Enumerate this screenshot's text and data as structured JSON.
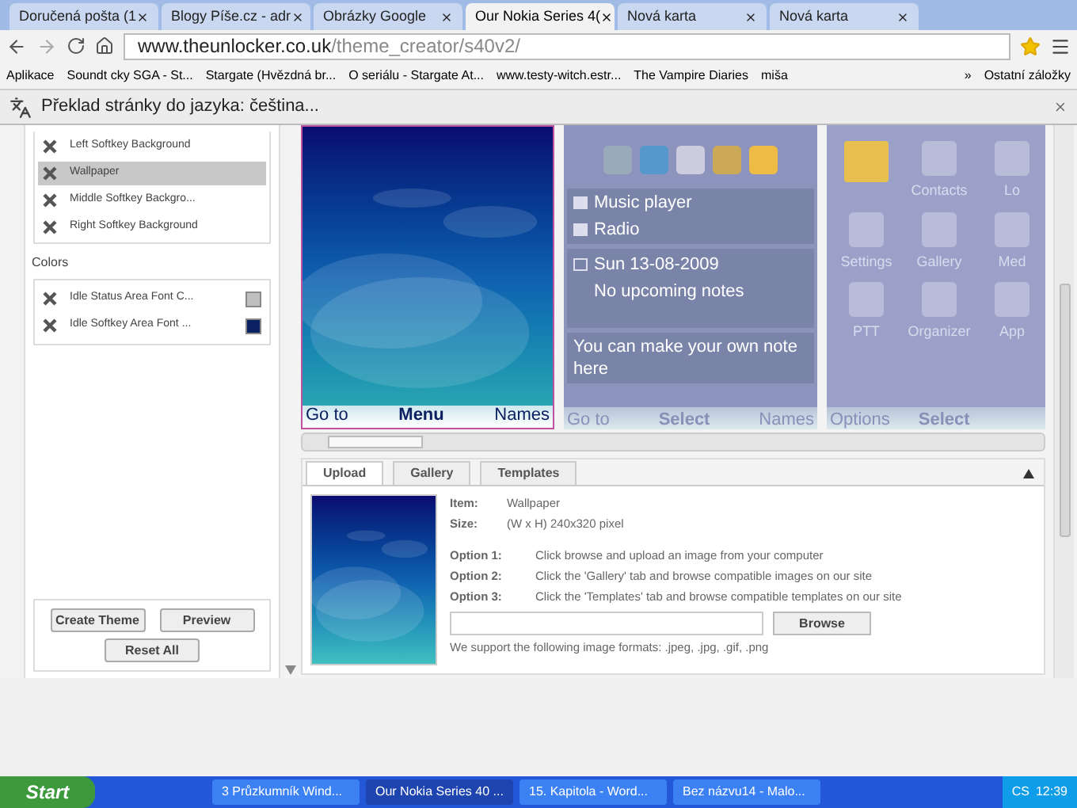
{
  "browser": {
    "tabs": [
      {
        "label": "Doručená pošta (1",
        "selected": false
      },
      {
        "label": "Blogy Píše.cz - adr",
        "selected": false
      },
      {
        "label": "Obrázky Google",
        "selected": false
      },
      {
        "label": "Our Nokia Series 4(",
        "selected": true
      },
      {
        "label": "Nová karta",
        "selected": false
      },
      {
        "label": "Nová karta",
        "selected": false
      }
    ],
    "address": {
      "host": "www.theunlocker.co.uk",
      "path": "/theme_creator/s40v2/"
    },
    "bookmarks": [
      {
        "label": "Aplikace"
      },
      {
        "label": "Soundt   cky SGA - St..."
      },
      {
        "label": "Stargate (Hvězdná br..."
      },
      {
        "label": "O seriálu - Stargate At..."
      },
      {
        "label": "www.testy-witch.estr..."
      },
      {
        "label": "The Vampire Diaries"
      },
      {
        "label": "miša"
      }
    ],
    "more_bookmarks": "»",
    "other_bookmarks": "Ostatní záložky",
    "translate_bar": "Překlad stránky do jazyka: čeština..."
  },
  "sidebar": {
    "items": [
      {
        "label": "Left Softkey Background",
        "selected": false
      },
      {
        "label": "Wallpaper",
        "selected": true
      },
      {
        "label": "Middle Softkey Backgro...",
        "selected": false
      },
      {
        "label": "Right Softkey Background",
        "selected": false
      }
    ],
    "colors_heading": "Colors",
    "colors": [
      {
        "label": "Idle Status Area Font C...",
        "color": "#c0c0c0"
      },
      {
        "label": "Idle Softkey Area Font ...",
        "color": "#0a2060"
      }
    ],
    "buttons": [
      "Create Theme",
      "Preview",
      "Reset All"
    ]
  },
  "previews": {
    "idle": {
      "softkeys": [
        "Go to",
        "Menu",
        "Names"
      ]
    },
    "active": {
      "items": [
        "Music player",
        "Radio"
      ],
      "date": "Sun 13-08-2009",
      "notes": "No upcoming notes",
      "note": "You can make your own note here",
      "softkeys": [
        "Go to",
        "Select",
        "Names"
      ]
    },
    "menu": {
      "labels": [
        "Contacts",
        "Lo",
        "Settings",
        "Gallery",
        "Med",
        "PTT",
        "Organizer",
        "App"
      ],
      "softkeys": [
        "Options",
        "Select"
      ]
    }
  },
  "upload": {
    "tabs": [
      {
        "label": "Upload",
        "selected": true
      },
      {
        "label": "Gallery",
        "selected": false
      },
      {
        "label": "Templates",
        "selected": false
      }
    ],
    "item_label": "Item:",
    "item_value": "Wallpaper",
    "size_label": "Size:",
    "size_value": "(W x H) 240x320 pixel",
    "options": [
      {
        "label": "Option 1:",
        "text": "Click browse and upload an image from your computer"
      },
      {
        "label": "Option 2:",
        "text": "Click the 'Gallery' tab and browse compatible images on our site"
      },
      {
        "label": "Option 3:",
        "text": "Click the 'Templates' tab and browse compatible templates on our site"
      }
    ],
    "browse": "Browse",
    "formats": "We support the following image formats: .jpeg, .jpg, .gif, .png"
  },
  "taskbar": {
    "start": "Start",
    "tasks": [
      {
        "label": "3 Průzkumník Wind...",
        "selected": false
      },
      {
        "label": "Our Nokia Series 40 ...",
        "selected": true
      },
      {
        "label": "15. Kapitola - Word...",
        "selected": false
      },
      {
        "label": "Bez názvu14 - Malo...",
        "selected": false
      }
    ],
    "language": "CS",
    "clock": "12:39"
  }
}
